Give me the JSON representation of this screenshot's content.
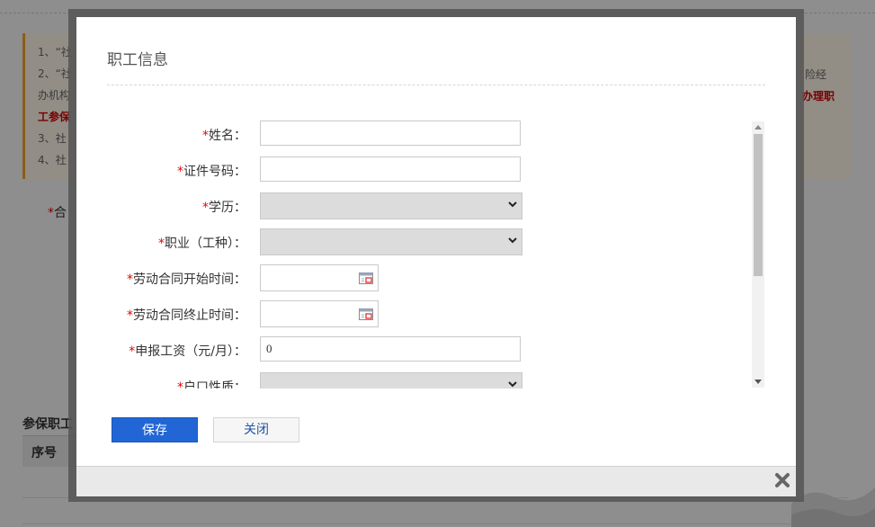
{
  "background": {
    "notice_lines": [
      "1、“社",
      "2、“社",
      "办机构",
      "工参保",
      "3、社",
      "4、社"
    ],
    "notice_right_1": "险经",
    "notice_right_2": "办理职",
    "field_label": "合",
    "section_title": "参保职工",
    "table_header_first": "序号"
  },
  "dialog": {
    "title": "职工信息",
    "fields": [
      {
        "label": "姓名：",
        "type": "text",
        "value": ""
      },
      {
        "label": "证件号码：",
        "type": "text",
        "value": ""
      },
      {
        "label": "学历：",
        "type": "select",
        "value": ""
      },
      {
        "label": "职业（工种）：",
        "type": "select",
        "value": ""
      },
      {
        "label": "劳动合同开始时间：",
        "type": "date",
        "value": ""
      },
      {
        "label": "劳动合同终止时间：",
        "type": "date",
        "value": ""
      },
      {
        "label": "申报工资（元/月）：",
        "type": "text",
        "value": "0"
      },
      {
        "label": "户口性质：",
        "type": "select",
        "value": ""
      }
    ],
    "required_marker": "*",
    "save_label": "保存",
    "close_label": "关闭"
  },
  "colors": {
    "accent": "#2266d6",
    "required": "#e00000",
    "notice_border": "#f0a030"
  },
  "icons": {
    "close": "close-x-icon",
    "calendar": "calendar-icon",
    "dropdown": "chevron-down-icon"
  }
}
